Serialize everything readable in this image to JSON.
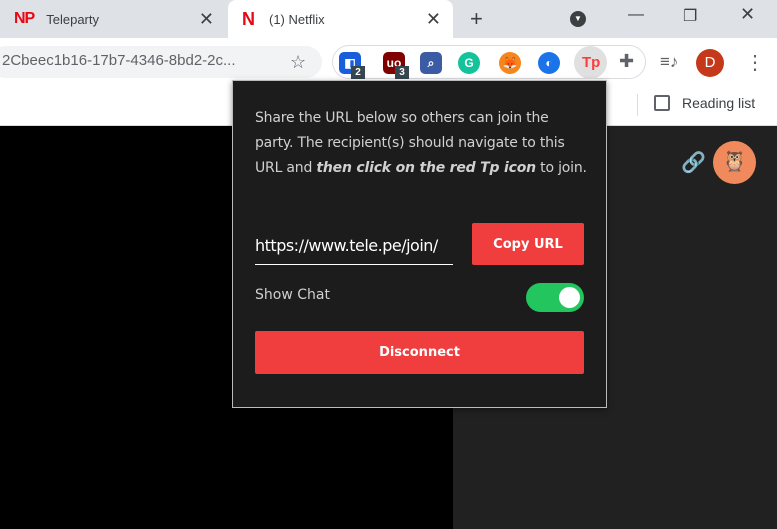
{
  "tabs": [
    {
      "label": "Teleparty",
      "icon": "NP"
    },
    {
      "label": "(1) Netflix",
      "icon": "N"
    }
  ],
  "address": {
    "url": "2Cbeec1b16-17b7-4346-8bd2-2c..."
  },
  "extensions": [
    {
      "name": "bitwarden",
      "badge": "2",
      "color": "#175ddc",
      "glyph": "◧"
    },
    {
      "name": "ublock",
      "badge": "3",
      "color": "#800000",
      "glyph": "uo"
    },
    {
      "name": "search-ext",
      "color": "#3b5ba5",
      "glyph": "⌕"
    },
    {
      "name": "grammarly",
      "color": "#15c39a",
      "glyph": "G"
    },
    {
      "name": "metamask",
      "color": "#f6851b",
      "glyph": "🦊"
    },
    {
      "name": "globe-ext",
      "color": "#1a73e8",
      "glyph": "◐"
    },
    {
      "name": "teleparty",
      "color": "#ff3b3b",
      "glyph": "Tp"
    }
  ],
  "profile": {
    "initial": "D",
    "color": "#c5391a"
  },
  "bookmarks": {
    "reading_list": "Reading list"
  },
  "popup": {
    "desc_1": "Share the URL below so others can join the party. The recipient(s) should navigate to this URL and ",
    "desc_bold": "then click on the red Tp icon",
    "desc_2": " to join.",
    "url_value": "https://www.tele.pe/join/",
    "copy_label": "Copy URL",
    "show_chat_label": "Show Chat",
    "show_chat_on": true,
    "disconnect_label": "Disconnect"
  }
}
